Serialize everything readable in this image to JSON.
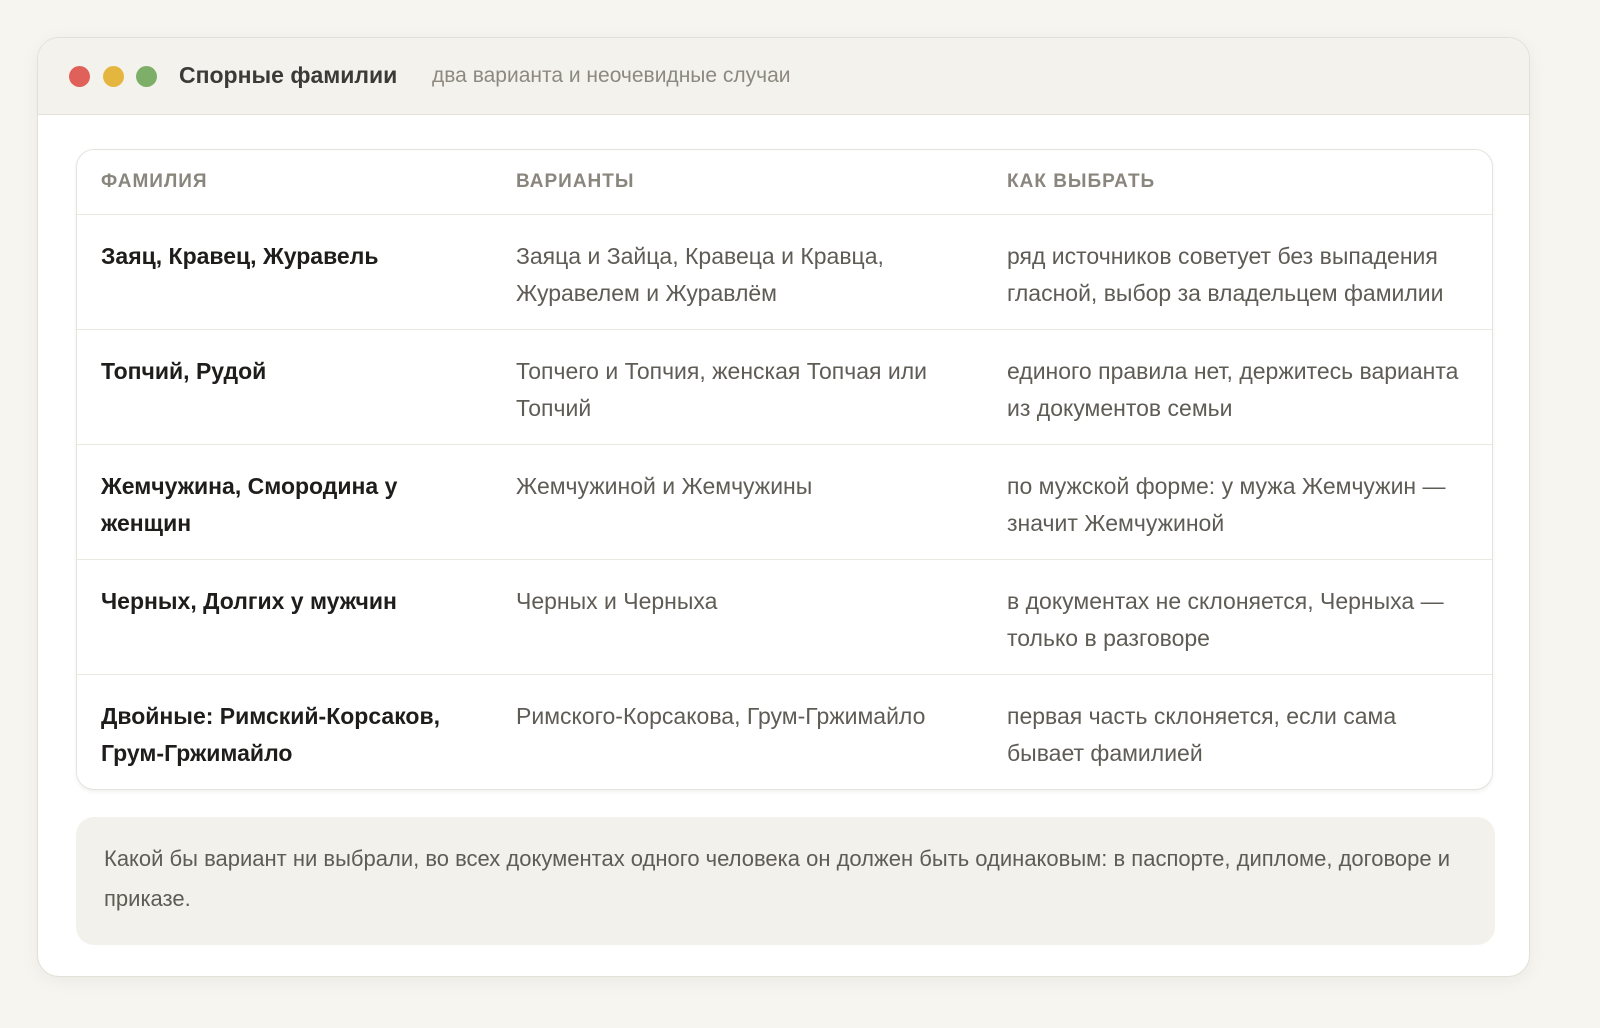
{
  "window": {
    "title": "Спорные фамилии",
    "subtitle": "два варианта и неочевидные случаи",
    "controls": [
      {
        "name": "close",
        "color": "#e0605a"
      },
      {
        "name": "minimize",
        "color": "#e5b63f"
      },
      {
        "name": "maximize",
        "color": "#7eaf68"
      }
    ]
  },
  "table": {
    "headers": [
      "ФАМИЛИЯ",
      "ВАРИАНТЫ",
      "КАК ВЫБРАТЬ"
    ],
    "rows": [
      {
        "surname": "Заяц, Кравец, Журавель",
        "variants": "Заяца и Зайца, Кравеца и Кравца, Журавелем и Журавлём",
        "how": "ряд источников советует без выпадения гласной, выбор за владельцем фамилии"
      },
      {
        "surname": "Топчий, Рудой",
        "variants": "Топчего и Топчия, женская Топчая или Топчий",
        "how": "единого правила нет, держитесь варианта из документов семьи"
      },
      {
        "surname": "Жемчужина, Смородина у женщин",
        "variants": "Жемчужиной и Жемчужины",
        "how": "по мужской форме: у мужа Жемчужин — значит Жемчужиной"
      },
      {
        "surname": "Черных, Долгих у мужчин",
        "variants": "Черных и Черныха",
        "how": "в документах не склоняется, Черныха — только в разговоре"
      },
      {
        "surname": "Двойные: Римский‑Корсаков, Грум‑Гржимайло",
        "variants": "Римского‑Корсакова, Грум‑Гржимайло",
        "how": "первая часть склоняется, если сама бывает фамилией"
      }
    ]
  },
  "note": "Какой бы вариант ни выбрали, во всех документах одного человека он должен быть одинаковым: в паспорте, дипломе, договоре и приказе."
}
